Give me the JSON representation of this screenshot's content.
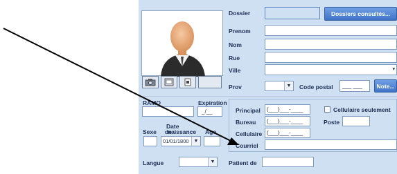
{
  "labels": {
    "dossier": "Dossier",
    "prenom": "Prenom",
    "nom": "Nom",
    "rue": "Rue",
    "ville": "Ville",
    "prov": "Prov",
    "code_postal": "Code postal",
    "ramq": "RAMQ",
    "expiration": "Expiration",
    "sexe": "Sexe",
    "date_naissance_line1": "Date",
    "date_naissance_line2": "de",
    "date_naissance_line2b": "naissance",
    "age": "Age",
    "principal": "Principal",
    "bureau": "Bureau",
    "cellulaire": "Cellulaire",
    "courriel": "Courriel",
    "cellulaire_seulement": "Cellulaire seulement",
    "poste": "Poste",
    "langue": "Langue",
    "patient_de": "Patient de"
  },
  "buttons": {
    "dossiers_consultes": "Dossiers consultés...",
    "note": "Note..."
  },
  "values": {
    "expiration": "_/__",
    "code_postal": "___ ___",
    "principal_phone": "(___)___-____",
    "bureau_phone": "(___)___-____",
    "cellulaire_phone": "(___)___-____",
    "date_naissance": "01/01/1800"
  },
  "icons": [
    "camera-icon",
    "scanner-icon",
    "document-icon",
    "blank-icon"
  ],
  "colors": {
    "panel": "#cfe0f2",
    "button": "#4a7fd0"
  }
}
